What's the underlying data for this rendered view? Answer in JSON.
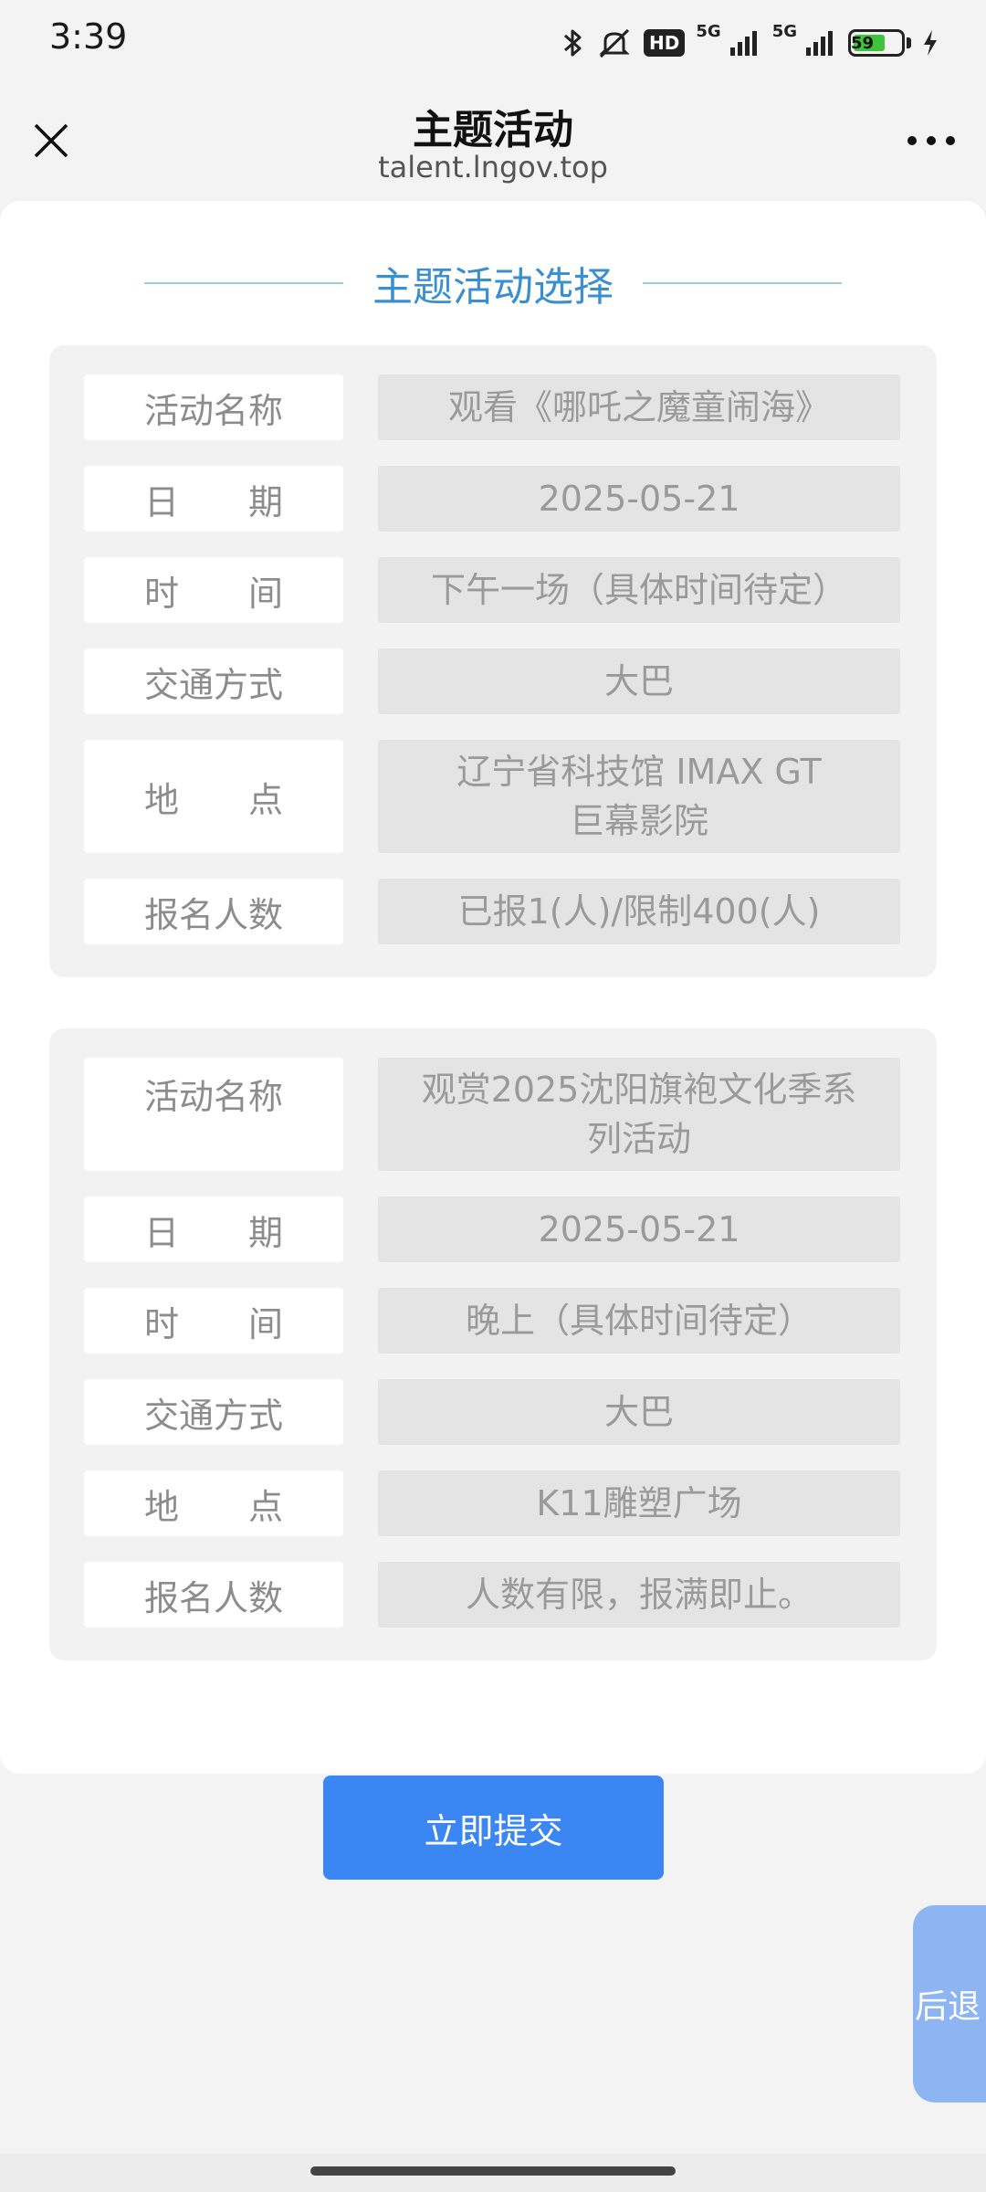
{
  "status_bar": {
    "time": "3:39",
    "hd_label": "HD",
    "network_1": "5G",
    "network_2": "5G",
    "battery_level": "59",
    "icons": [
      "bluetooth-icon",
      "mute-icon",
      "hd-icon",
      "signal-icon",
      "signal-icon",
      "battery-icon",
      "charging-icon"
    ]
  },
  "header": {
    "title": "主题活动",
    "url": "talent.lngov.top",
    "close_icon": "close-icon",
    "more_icon": "more-dots-icon"
  },
  "main": {
    "section_title": "主题活动选择",
    "activities": [
      {
        "rows": [
          {
            "label": "活动名称",
            "value": "观看《哪吒之魔童闹海》"
          },
          {
            "label": "日　　期",
            "value": "2025-05-21"
          },
          {
            "label": "时　　间",
            "value": "下午一场（具体时间待定）"
          },
          {
            "label": "交通方式",
            "value": "大巴"
          },
          {
            "label": "地　　点",
            "value": "辽宁省科技馆 IMAX GT巨幕影院"
          },
          {
            "label": "报名人数",
            "value": "已报1(人)/限制400(人)"
          }
        ]
      },
      {
        "rows": [
          {
            "label": "活动名称",
            "value": "观赏2025沈阳旗袍文化季系列活动"
          },
          {
            "label": "日　　期",
            "value": "2025-05-21"
          },
          {
            "label": "时　　间",
            "value": "晚上（具体时间待定）"
          },
          {
            "label": "交通方式",
            "value": "大巴"
          },
          {
            "label": "地　　点",
            "value": "K11雕塑广场"
          },
          {
            "label": "报名人数",
            "value": "人数有限，报满即止。"
          }
        ]
      }
    ]
  },
  "submit_label": "立即提交",
  "back_label": "后退",
  "colors": {
    "accent": "#3a86f2",
    "heading": "#3a8fd0",
    "back_button": "#8db5f2"
  }
}
